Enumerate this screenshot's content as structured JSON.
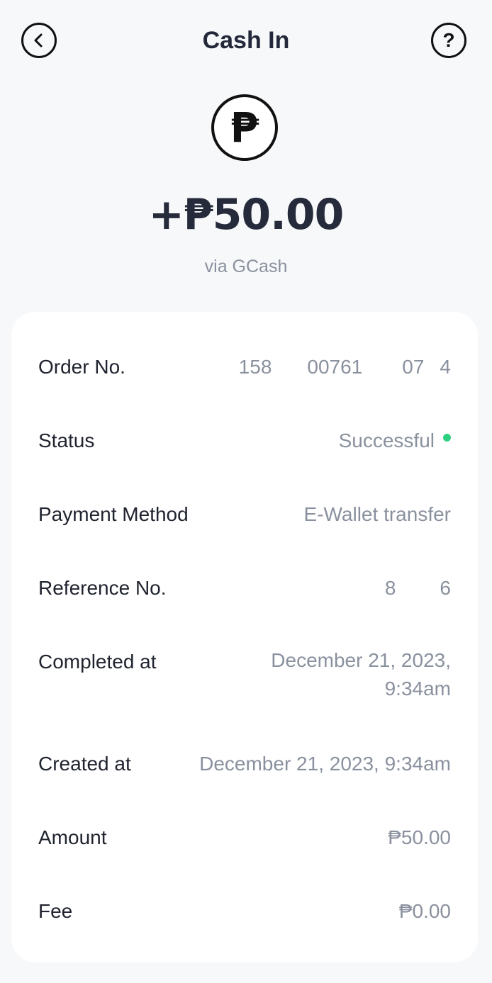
{
  "header": {
    "title": "Cash In",
    "back_icon": "chevron-left-circle-icon",
    "help_icon": "question-circle-icon"
  },
  "summary": {
    "currency_symbol": "₱",
    "amount": "+₱50.00",
    "via": "via GCash"
  },
  "details": {
    "order_no": {
      "label": "Order No.",
      "parts": [
        "158",
        "00761",
        "07",
        "4"
      ]
    },
    "status": {
      "label": "Status",
      "value": "Successful",
      "dot_color": "#2ccf80"
    },
    "payment_method": {
      "label": "Payment Method",
      "value": "E-Wallet transfer"
    },
    "reference_no": {
      "label": "Reference No.",
      "parts": [
        "8",
        "6"
      ]
    },
    "completed_at": {
      "label": "Completed at",
      "line1": "December 21, 2023,",
      "line2": "9:34am"
    },
    "created_at": {
      "label": "Created at",
      "value": "December 21, 2023, 9:34am"
    },
    "amount": {
      "label": "Amount",
      "value": "₱50.00"
    },
    "fee": {
      "label": "Fee",
      "value": "₱0.00"
    }
  }
}
